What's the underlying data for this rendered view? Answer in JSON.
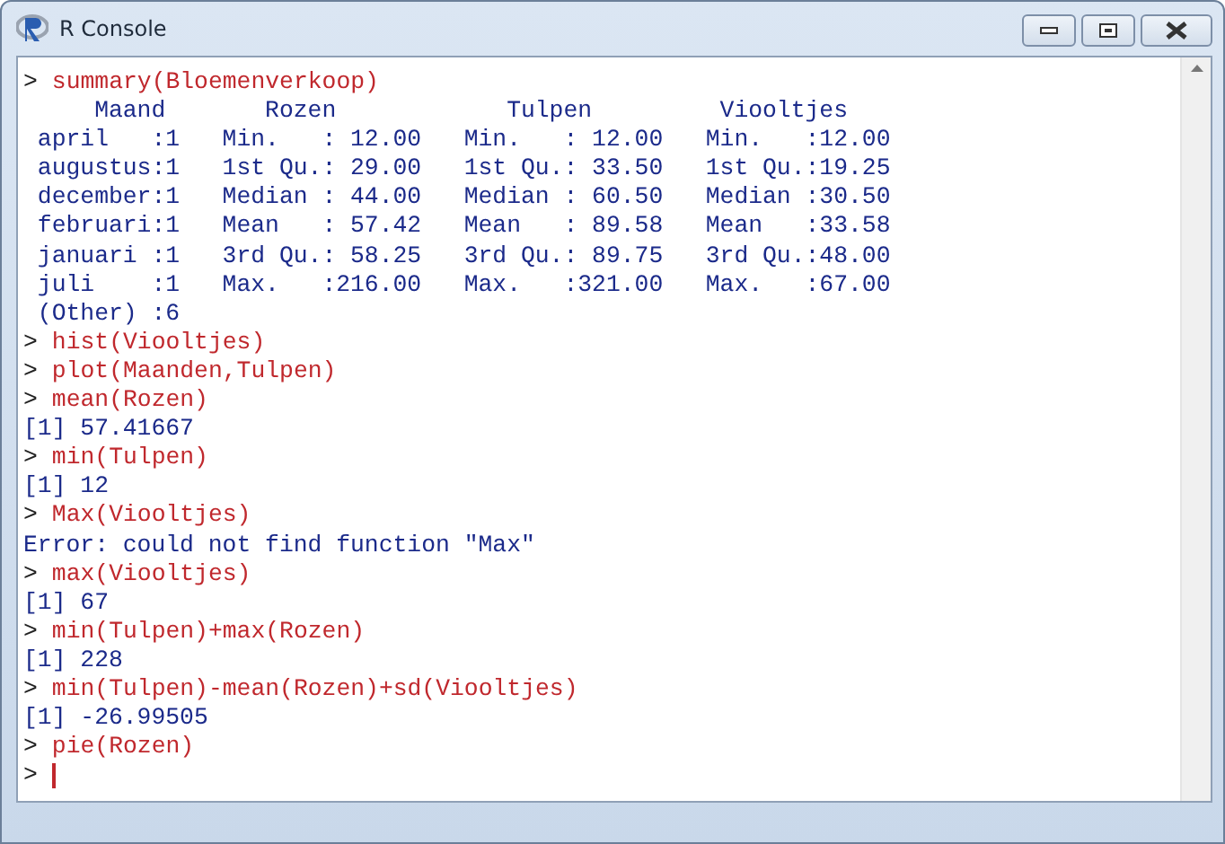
{
  "window": {
    "title": "R Console"
  },
  "console": {
    "lines": [
      {
        "kind": "input",
        "prompt": ">",
        "text": "summary(Bloemenverkoop)"
      },
      {
        "kind": "output",
        "text": "     Maand       Rozen            Tulpen         Viooltjes   "
      },
      {
        "kind": "output",
        "text": " april   :1   Min.   : 12.00   Min.   : 12.00   Min.   :12.00  "
      },
      {
        "kind": "output",
        "text": " augustus:1   1st Qu.: 29.00   1st Qu.: 33.50   1st Qu.:19.25  "
      },
      {
        "kind": "output",
        "text": " december:1   Median : 44.00   Median : 60.50   Median :30.50  "
      },
      {
        "kind": "output",
        "text": " februari:1   Mean   : 57.42   Mean   : 89.58   Mean   :33.58  "
      },
      {
        "kind": "output",
        "text": " januari :1   3rd Qu.: 58.25   3rd Qu.: 89.75   3rd Qu.:48.00  "
      },
      {
        "kind": "output",
        "text": " juli    :1   Max.   :216.00   Max.   :321.00   Max.   :67.00  "
      },
      {
        "kind": "output",
        "text": " (Other) :6  "
      },
      {
        "kind": "input",
        "prompt": ">",
        "text": "hist(Viooltjes)"
      },
      {
        "kind": "input",
        "prompt": ">",
        "text": "plot(Maanden,Tulpen)"
      },
      {
        "kind": "input",
        "prompt": ">",
        "text": "mean(Rozen)"
      },
      {
        "kind": "output",
        "text": "[1] 57.41667"
      },
      {
        "kind": "input",
        "prompt": ">",
        "text": "min(Tulpen)"
      },
      {
        "kind": "output",
        "text": "[1] 12"
      },
      {
        "kind": "input",
        "prompt": ">",
        "text": "Max(Viooltjes)"
      },
      {
        "kind": "output",
        "text": "Error: could not find function \"Max\""
      },
      {
        "kind": "input",
        "prompt": ">",
        "text": "max(Viooltjes)"
      },
      {
        "kind": "output",
        "text": "[1] 67"
      },
      {
        "kind": "input",
        "prompt": ">",
        "text": "min(Tulpen)+max(Rozen)"
      },
      {
        "kind": "output",
        "text": "[1] 228"
      },
      {
        "kind": "input",
        "prompt": ">",
        "text": "min(Tulpen)-mean(Rozen)+sd(Viooltjes)"
      },
      {
        "kind": "output",
        "text": "[1] -26.99505"
      },
      {
        "kind": "input",
        "prompt": ">",
        "text": "pie(Rozen)"
      },
      {
        "kind": "prompt",
        "prompt": ">"
      }
    ]
  }
}
